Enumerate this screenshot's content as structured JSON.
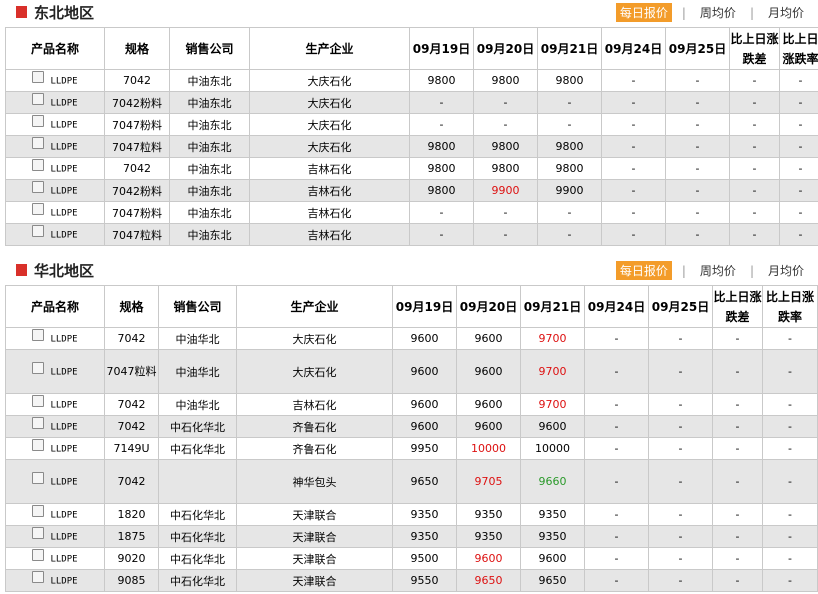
{
  "sections": [
    {
      "title": "东北地区",
      "tabs": [
        "每日报价",
        "周均价",
        "月均价"
      ],
      "headers": [
        "产品名称",
        "规格",
        "销售公司",
        "生产企业",
        "09月19日",
        "09月20日",
        "09月21日",
        "09月24日",
        "09月25日",
        "比上日涨跌差",
        "比上日涨跌率"
      ],
      "rows": [
        {
          "product": "LLDPE",
          "spec": "7042",
          "sales": "中油东北",
          "producer": "大庆石化",
          "d19": "9800",
          "d20": "9800",
          "d21": "9800",
          "d24": "-",
          "d25": "-",
          "diff": "-",
          "rate": "-"
        },
        {
          "product": "LLDPE",
          "spec": "7042粉料",
          "sales": "中油东北",
          "producer": "大庆石化",
          "d19": "-",
          "d20": "-",
          "d21": "-",
          "d24": "-",
          "d25": "-",
          "diff": "-",
          "rate": "-"
        },
        {
          "product": "LLDPE",
          "spec": "7047粉料",
          "sales": "中油东北",
          "producer": "大庆石化",
          "d19": "-",
          "d20": "-",
          "d21": "-",
          "d24": "-",
          "d25": "-",
          "diff": "-",
          "rate": "-"
        },
        {
          "product": "LLDPE",
          "spec": "7047粒料",
          "sales": "中油东北",
          "producer": "大庆石化",
          "d19": "9800",
          "d20": "9800",
          "d21": "9800",
          "d24": "-",
          "d25": "-",
          "diff": "-",
          "rate": "-"
        },
        {
          "product": "LLDPE",
          "spec": "7042",
          "sales": "中油东北",
          "producer": "吉林石化",
          "d19": "9800",
          "d20": "9800",
          "d21": "9800",
          "d24": "-",
          "d25": "-",
          "diff": "-",
          "rate": "-"
        },
        {
          "product": "LLDPE",
          "spec": "7042粉料",
          "sales": "中油东北",
          "producer": "吉林石化",
          "d19": "9800",
          "d20": "9900",
          "d20_color": "red",
          "d21": "9900",
          "d24": "-",
          "d25": "-",
          "diff": "-",
          "rate": "-"
        },
        {
          "product": "LLDPE",
          "spec": "7047粉料",
          "sales": "中油东北",
          "producer": "吉林石化",
          "d19": "-",
          "d20": "-",
          "d21": "-",
          "d24": "-",
          "d25": "-",
          "diff": "-",
          "rate": "-"
        },
        {
          "product": "LLDPE",
          "spec": "7047粒料",
          "sales": "中油东北",
          "producer": "吉林石化",
          "d19": "-",
          "d20": "-",
          "d21": "-",
          "d24": "-",
          "d25": "-",
          "diff": "-",
          "rate": "-"
        }
      ]
    },
    {
      "title": "华北地区",
      "tabs": [
        "每日报价",
        "周均价",
        "月均价"
      ],
      "headers": [
        "产品名称",
        "规格",
        "销售公司",
        "生产企业",
        "09月19日",
        "09月20日",
        "09月21日",
        "09月24日",
        "09月25日",
        "比上日涨跌差",
        "比上日涨跌率"
      ],
      "rows": [
        {
          "product": "LLDPE",
          "spec": "7042",
          "sales": "中油华北",
          "producer": "大庆石化",
          "d19": "9600",
          "d20": "9600",
          "d21": "9700",
          "d21_color": "red",
          "d24": "-",
          "d25": "-",
          "diff": "-",
          "rate": "-"
        },
        {
          "product": "LLDPE",
          "spec": "7047粒料",
          "sales": "中油华北",
          "producer": "大庆石化",
          "d19": "9600",
          "d20": "9600",
          "d21": "9700",
          "d21_color": "red",
          "d24": "-",
          "d25": "-",
          "diff": "-",
          "rate": "-"
        },
        {
          "product": "LLDPE",
          "spec": "7042",
          "sales": "中油华北",
          "producer": "吉林石化",
          "d19": "9600",
          "d20": "9600",
          "d21": "9700",
          "d21_color": "red",
          "d24": "-",
          "d25": "-",
          "diff": "-",
          "rate": "-"
        },
        {
          "product": "LLDPE",
          "spec": "7042",
          "sales": "中石化华北",
          "producer": "齐鲁石化",
          "d19": "9600",
          "d20": "9600",
          "d21": "9600",
          "d24": "-",
          "d25": "-",
          "diff": "-",
          "rate": "-"
        },
        {
          "product": "LLDPE",
          "spec": "7149U",
          "sales": "中石化华北",
          "producer": "齐鲁石化",
          "d19": "9950",
          "d20": "10000",
          "d20_color": "red",
          "d21": "10000",
          "d24": "-",
          "d25": "-",
          "diff": "-",
          "rate": "-"
        },
        {
          "product": "LLDPE",
          "spec": "7042",
          "sales": "",
          "producer": "神华包头",
          "d19": "9650",
          "d20": "9705",
          "d20_color": "red",
          "d21": "9660",
          "d21_color": "green",
          "d24": "-",
          "d25": "-",
          "diff": "-",
          "rate": "-"
        },
        {
          "product": "LLDPE",
          "spec": "1820",
          "sales": "中石化华北",
          "producer": "天津联合",
          "d19": "9350",
          "d20": "9350",
          "d21": "9350",
          "d24": "-",
          "d25": "-",
          "diff": "-",
          "rate": "-"
        },
        {
          "product": "LLDPE",
          "spec": "1875",
          "sales": "中石化华北",
          "producer": "天津联合",
          "d19": "9350",
          "d20": "9350",
          "d21": "9350",
          "d24": "-",
          "d25": "-",
          "diff": "-",
          "rate": "-"
        },
        {
          "product": "LLDPE",
          "spec": "9020",
          "sales": "中石化华北",
          "producer": "天津联合",
          "d19": "9500",
          "d20": "9600",
          "d20_color": "red",
          "d21": "9600",
          "d24": "-",
          "d25": "-",
          "diff": "-",
          "rate": "-"
        },
        {
          "product": "LLDPE",
          "spec": "9085",
          "sales": "中石化华北",
          "producer": "天津联合",
          "d19": "9550",
          "d20": "9650",
          "d20_color": "red",
          "d21": "9650",
          "d24": "-",
          "d25": "-",
          "diff": "-",
          "rate": "-"
        }
      ]
    }
  ]
}
